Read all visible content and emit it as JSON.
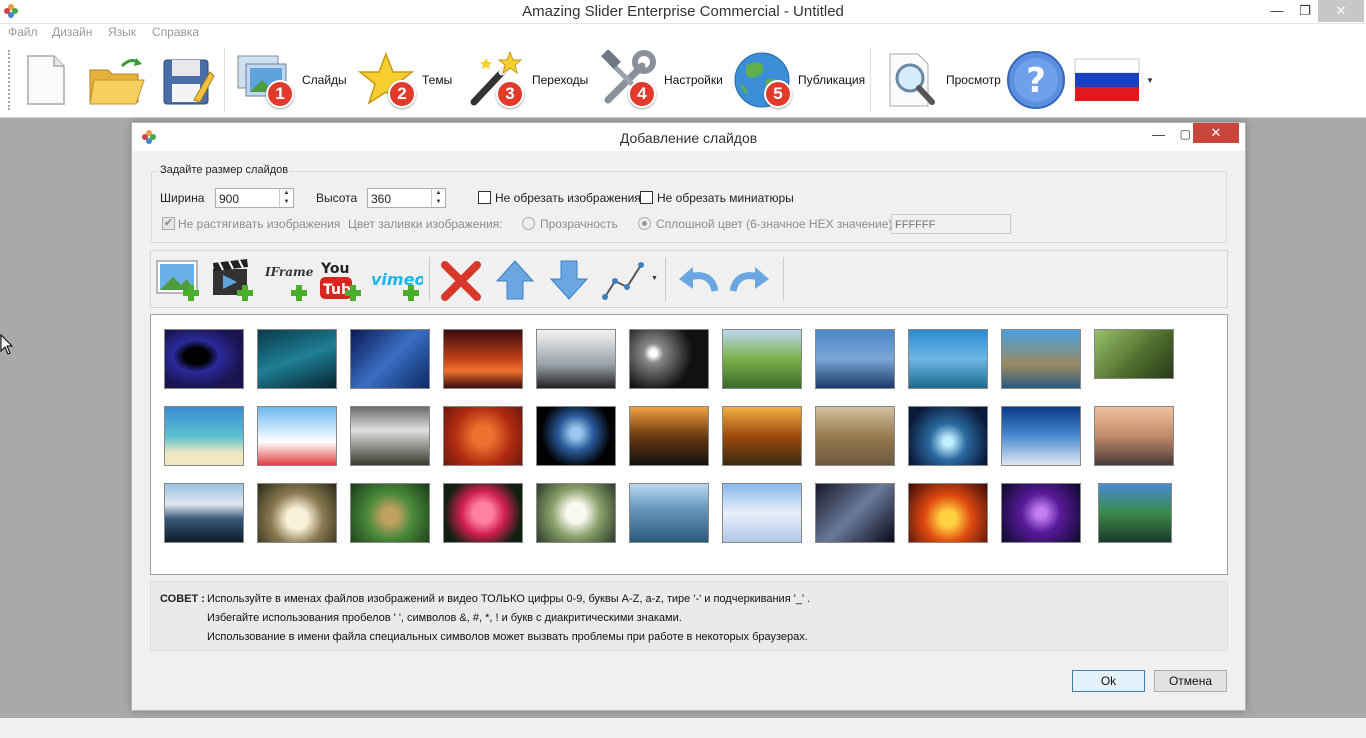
{
  "app": {
    "title": "Amazing Slider Enterprise Commercial - Untitled",
    "menu": [
      "Файл",
      "Дизайн",
      "Язык",
      "Справка"
    ]
  },
  "toolbar": {
    "steps": [
      {
        "label": "Слайды",
        "num": "1",
        "icon": "slides-icon"
      },
      {
        "label": "Темы",
        "num": "2",
        "icon": "star-icon"
      },
      {
        "label": "Переходы",
        "num": "3",
        "icon": "magic-wand-icon"
      },
      {
        "label": "Настройки",
        "num": "4",
        "icon": "tools-icon"
      },
      {
        "label": "Публикация",
        "num": "5",
        "icon": "globe-icon"
      }
    ],
    "preview_label": "Просмотр"
  },
  "dialog": {
    "title": "Добавление слайдов",
    "size_group_label": "Задайте размер слайдов",
    "width_label": "Ширина",
    "width_value": "900",
    "height_label": "Высота",
    "height_value": "360",
    "no_crop_images": "Не обрезать изображения",
    "no_crop_thumbs": "Не обрезать миниатюры",
    "no_stretch": "Не растягивать изображения",
    "fill_color_label": "Цвет заливки изображения:",
    "transparent_label": "Прозрачность",
    "solid_label": "Сплошной цвет (6-значное HEX значение):",
    "hex_value": "FFFFFF",
    "iframe_label": "IFrame",
    "tip_label": "СОВЕТ :",
    "tip_lines": [
      "Используйте в именах файлов изображений и видео ТОЛЬКО цифры 0-9, буквы A-Z, a-z, тире '-' и подчеркивания '_' .",
      "Избегайте использования пробелов ' ', символов &, #, *, ! и букв с диакритическими знаками.",
      "Использование в имени файла специальных символов может вызвать проблемы при работе в некоторых браузерах."
    ],
    "ok_label": "Ok",
    "cancel_label": "Отмена"
  },
  "colors": {
    "badge": "#e23a2a",
    "accent": "#3c7fb1",
    "close": "#c9463d"
  }
}
